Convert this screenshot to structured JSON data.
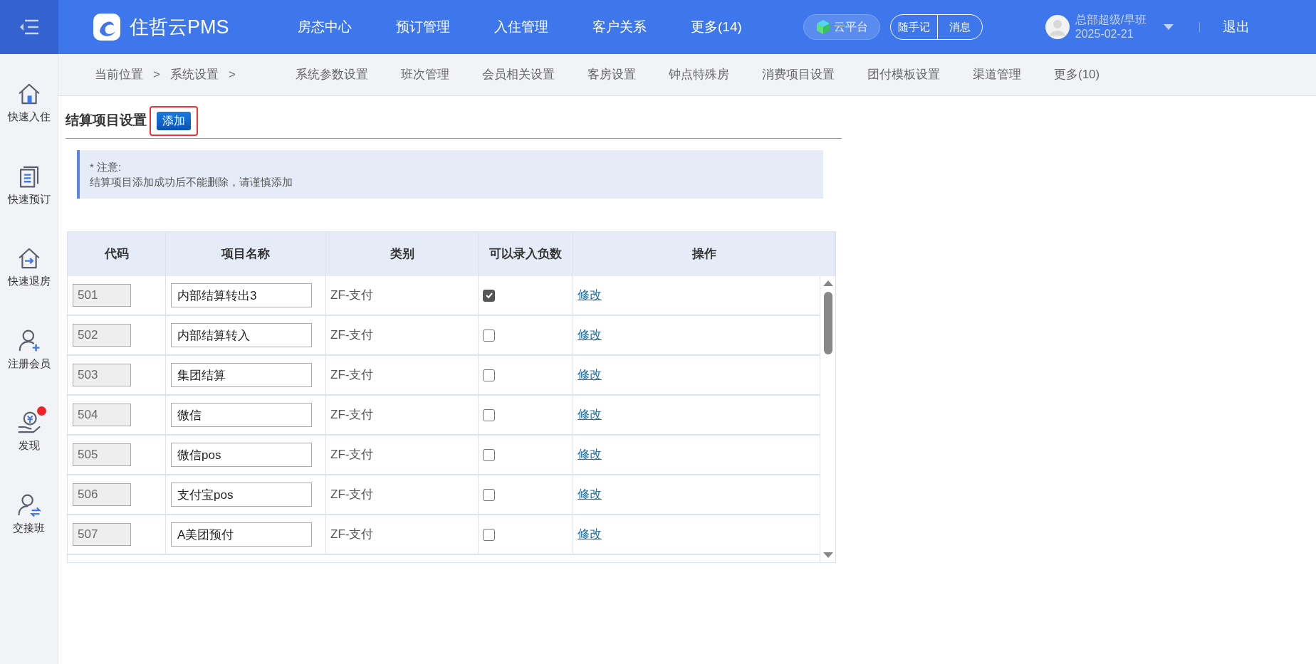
{
  "header": {
    "brand": "住哲云PMS",
    "nav": [
      "房态中心",
      "预订管理",
      "入住管理",
      "客户关系",
      "更多(14)"
    ],
    "cloud_button": "云平台",
    "quick_buttons": [
      "随手记",
      "消息"
    ],
    "user": {
      "name": "总部超级/早班",
      "date": "2025-02-21"
    },
    "logout": "退出"
  },
  "sidebar": {
    "items": [
      {
        "label": "快速入住",
        "notification": false
      },
      {
        "label": "快速预订",
        "notification": false
      },
      {
        "label": "快速退房",
        "notification": false
      },
      {
        "label": "注册会员",
        "notification": false
      },
      {
        "label": "发现",
        "notification": true
      },
      {
        "label": "交接班",
        "notification": false
      }
    ]
  },
  "breadcrumb": [
    "当前位置",
    ">",
    "系统设置",
    ">"
  ],
  "subnav": [
    "系统参数设置",
    "班次管理",
    "会员相关设置",
    "客房设置",
    "钟点特殊房",
    "消费项目设置",
    "团付模板设置",
    "渠道管理",
    "更多(10)"
  ],
  "section": {
    "title": "结算项目设置",
    "add_button": "添加",
    "add_button_highlighted": true
  },
  "notice": {
    "title": "* 注意:",
    "text": "结算项目添加成功后不能删除，请谨慎添加"
  },
  "table": {
    "columns": [
      "代码",
      "项目名称",
      "类别",
      "可以录入负数",
      "操作"
    ],
    "rows": [
      {
        "code": "501",
        "name": "内部结算转出3",
        "category": "ZF-支付",
        "negative_allowed": true,
        "action": "修改"
      },
      {
        "code": "502",
        "name": "内部结算转入",
        "category": "ZF-支付",
        "negative_allowed": false,
        "action": "修改"
      },
      {
        "code": "503",
        "name": "集团结算",
        "category": "ZF-支付",
        "negative_allowed": false,
        "action": "修改"
      },
      {
        "code": "504",
        "name": "微信",
        "category": "ZF-支付",
        "negative_allowed": false,
        "action": "修改"
      },
      {
        "code": "505",
        "name": "微信pos",
        "category": "ZF-支付",
        "negative_allowed": false,
        "action": "修改"
      },
      {
        "code": "506",
        "name": "支付宝pos",
        "category": "ZF-支付",
        "negative_allowed": false,
        "action": "修改"
      },
      {
        "code": "507",
        "name": "A美团预付",
        "category": "ZF-支付",
        "negative_allowed": false,
        "action": "修改"
      }
    ]
  }
}
